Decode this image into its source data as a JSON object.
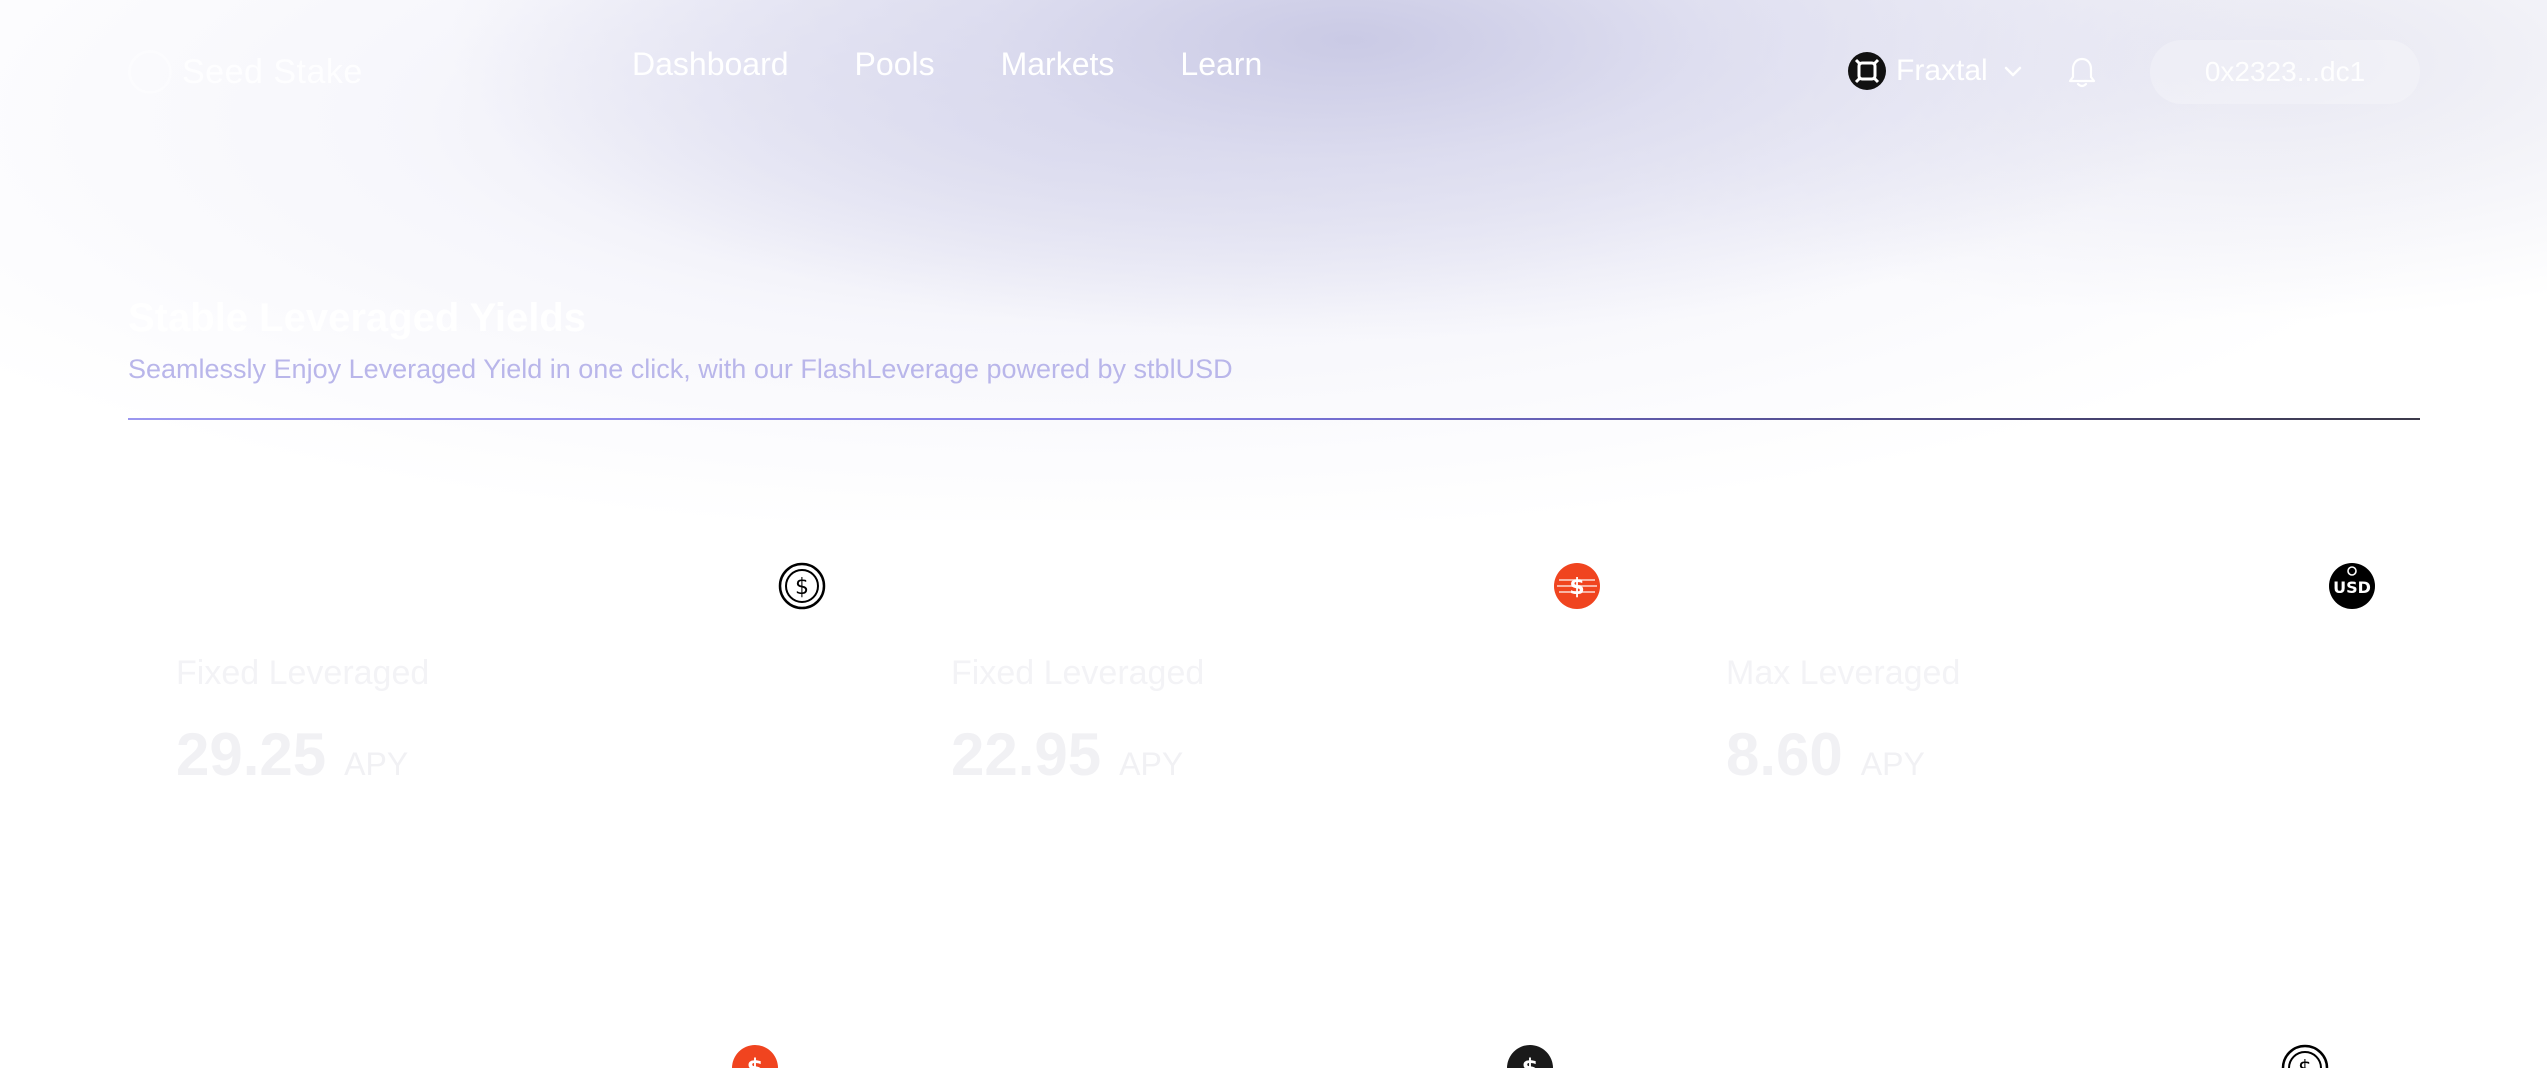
{
  "header": {
    "logo_text": "Seed Stake",
    "nav": [
      {
        "label": "Dashboard"
      },
      {
        "label": "Pools"
      },
      {
        "label": "Markets"
      },
      {
        "label": "Learn"
      }
    ],
    "network": {
      "label": "Fraxtal",
      "icon": "fraxtal-icon"
    },
    "wallet_address": "0x2323...dc1"
  },
  "section": {
    "title": "Stable Leveraged Yields",
    "subtitle": "Seamlessly Enjoy Leveraged Yield in one click, with our FlashLeverage powered by stblUSD"
  },
  "cards": [
    {
      "label": "Fixed Leveraged",
      "value": "29.25",
      "unit": "APY",
      "icon": "usdc-icon",
      "icon_color": "#000000"
    },
    {
      "label": "Fixed Leveraged",
      "value": "22.95",
      "unit": "APY",
      "icon": "stable-token-icon",
      "icon_color": "#f0441f"
    },
    {
      "label": "Max Leveraged",
      "value": "8.60",
      "unit": "APY",
      "icon": "usd-icon",
      "icon_color": "#000000"
    }
  ],
  "second_row_icons": [
    {
      "icon": "stable-token-icon",
      "color": "#f0441f"
    },
    {
      "icon": "dollar-icon",
      "color": "#1a1a1a"
    },
    {
      "icon": "usdc-icon",
      "color": "#000000"
    }
  ],
  "colors": {
    "accent": "#7f79e6",
    "subtitle": "#b9b6ea",
    "orange": "#f0441f"
  }
}
